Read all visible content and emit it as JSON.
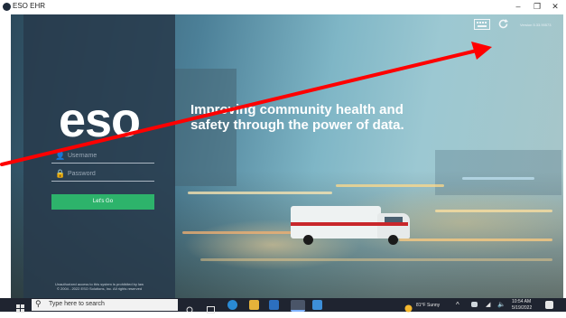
{
  "window": {
    "title": "ESO EHR",
    "minimize": "–",
    "maximize": "❐",
    "close": "✕"
  },
  "login": {
    "logo": "eso",
    "username_placeholder": "Username",
    "password_placeholder": "Password",
    "submit_label": "Let's Go",
    "legal_line1": "Unauthorized access to this system is prohibited by law",
    "legal_line2": "© 2004 - 2022 ESO Solutions, Inc. All rights reserved"
  },
  "hero": {
    "tagline": "Improving community health and safety through the power of data."
  },
  "toolbar": {
    "keyboard_icon": "keyboard-icon",
    "refresh_icon": "refresh-icon",
    "version": "Version 5.33.90573"
  },
  "annotation": {
    "arrow_color": "#ff0000"
  },
  "taskbar": {
    "search_placeholder": "Type here to search",
    "weather": "81°F  Sunny",
    "time": "10:54 AM",
    "date": "5/19/2022"
  },
  "colors": {
    "panel": "#283a4c",
    "accent_green": "#2db36b",
    "taskbar": "#1f2430"
  }
}
